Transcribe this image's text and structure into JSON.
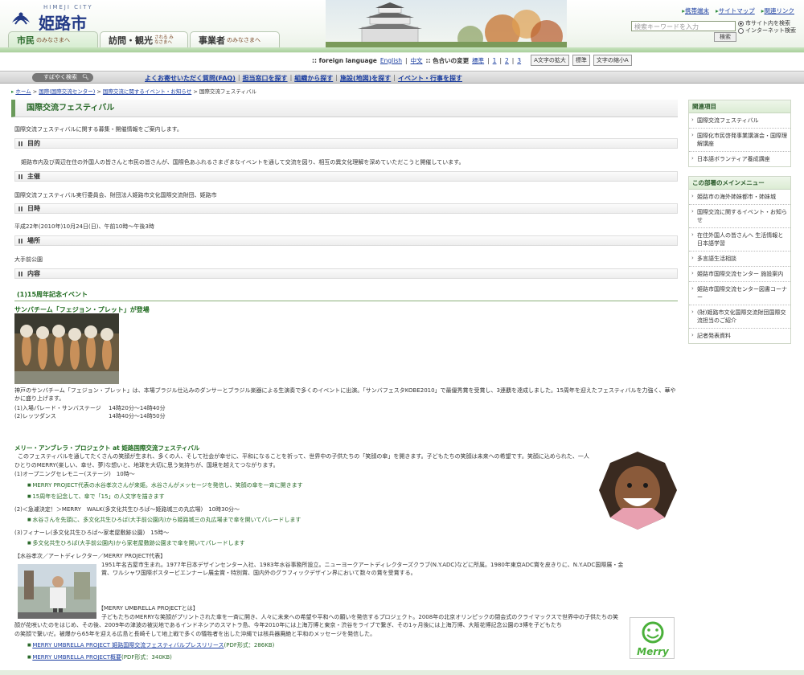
{
  "header": {
    "logo_sub": "HIMEJI CITY",
    "logo_name": "姫路市",
    "top_links": [
      "携帯端末",
      "サイトマップ",
      "関連リンク"
    ],
    "search_placeholder": "検索キーワードを入力",
    "search_button": "検索",
    "radio_site": "市サイト内を検索",
    "radio_web": "インターネット検索",
    "tabs": [
      {
        "big": "市民",
        "small": "のみなさまへ"
      },
      {
        "big": "訪問・観光",
        "small": "される みなさまへ"
      },
      {
        "big": "事業者",
        "small": "のみなさまへ"
      }
    ]
  },
  "accessibility": {
    "foreign_label": ":: foreign language",
    "english": "English",
    "chinese": "中文",
    "color_label": ":: 色合いの変更",
    "color_std": "標準",
    "color_1": "1",
    "color_2": "2",
    "color_3": "3",
    "font_up": "A文字の拡大",
    "font_std": "標準",
    "font_down": "文字の縮小A"
  },
  "nav": {
    "quick_search": "すばやく検索",
    "links": [
      "よくお寄せいただく質問(FAQ)",
      "担当窓口を探す",
      "組織から探す",
      "施設(地図)を探す",
      "イベント・行事を探す"
    ]
  },
  "breadcrumb": {
    "home": "ホーム",
    "c1": "国際(国際交流センター)",
    "c2": "国際交流に関するイベント・お知らせ",
    "current": "国際交流フェスティバル"
  },
  "page": {
    "title": "国際交流フェスティバル",
    "intro": "国際交流フェスティバルに関する募集・開催情報をご案内します。",
    "sections": {
      "purpose_h": "目的",
      "purpose": "姫路市内及び周辺在住の外国人の皆さんと市民の皆さんが、国際色あふれるさまざまなイベントを通して交流を図り、相互の異文化理解を深めていただこうと開催しています。",
      "host_h": "主催",
      "host": "国際交流フェスティバル実行委員会、財団法人姫路市文化国際交流財団、姫路市",
      "date_h": "日時",
      "date": "平成22年(2010年)10月24日(日)、午前10時～午後3時",
      "place_h": "場所",
      "place": "大手前公園",
      "content_h": "内容"
    },
    "event_heading": "(1)15周年記念イベント",
    "samba_heading": "サンバチーム「フェジョン・プレット」が登場",
    "samba_text": "神戸のサンバチーム「フェジョン・プレット」は、本場ブラジル仕込みのダンサーとブラジル楽器による生演奏で多くのイベントに出演。「サンバフェスタKOBE2010」で最優秀賞を受賞し、3連覇を達成しました。15周年を迎えたフェスティバルを力強く、華やかに盛り上げます。",
    "samba_sched": [
      {
        "label": "(1)入場パレード・サンバステージ",
        "time": "14時20分～14時40分"
      },
      {
        "label": "(2)レッツダンス",
        "time": "14時40分～14時50分"
      }
    ],
    "merry_heading": "メリー・アンブレラ・プロジェクト at 姫路国際交流フェスティバル",
    "merry_text1": "このフェスティバルを通してたくさんの笑顔が生まれ、多くの人、そして社会が幸せに、平和になることを祈って、世界中の子供たちの「笑顔の傘」を開きます。子どもたちの笑顔は未来への希望です。笑顔に込められた、一人",
    "merry_text2": "ひとりのMERRY(楽しい、幸せ、夢)な想いと、地球を大切に思う気持ちが、国境を越えてつながります。",
    "opening": "(1)オープニングセレモニー(ステージ)　10時～",
    "opening_b1": "MERRY PROJECT代表の水谷孝次さんが来姫。水谷さんがメッセージを発信し、笑顔の傘を一斉に開きます",
    "opening_b2": "15周年を記念して、傘で「15」の人文字を描きます",
    "walk": "(2)＜急遽決定！＞MERRY　WALK(多文化共生ひろば～姫路城三の丸広場)　10時30分～",
    "walk_b1": "水谷さんを先頭に、多文化共生ひろば(大手前公園内)から姫路城三の丸広場まで傘を開いてパレードします",
    "finale": "(3)フィナーレ(多文化共生ひろば～家老屋敷跡公園)　15時～",
    "finale_b1": "多文化共生ひろば(大手前公園内)から家老屋敷跡公園まで傘を開いてパレードします",
    "director_heading": "【水谷孝次／アートディレクター／MERRY PROJECT代表】",
    "director_text": "1951年名古屋市生まれ。1977年日本デザインセンター入社、1983年水谷事務所設立。ニューヨークアートディレクターズクラブ(N.Y.ADC)などに所属。1980年東京ADC賞を皮きりに、N.Y.ADC国際展・金賞、ワルシャワ国際ポスタービエンナーレ展金賞・特別賞、国内外のグラフィックデザイン界において数々の賞を受賞する。",
    "about_heading": "【MERRY UMBRELLA PROJECTとは】",
    "about_text1": "子どもたちのMERRYな笑顔がプリントされた傘を一斉に開き、人々に未来への希望や平和への願いを発信するプロジェクト。2008年の北京オリンピックの閉会式のクライマックスで世界中の子供たちの笑",
    "about_text2": "顔が花咲いたのをはじめ、その後、2009年の津波の被災地であるインドネシアのスマトラ島、今年2010年には上海万博と東京・渋谷をライブで繋ぎ、その1ヶ月後には上海万博、大阪花博記念公園の3博を子どもたち",
    "about_text3": "の笑顔で繋いだ。被爆から65年を迎える広島と長崎そして地上戦で多くの犠牲者を出した沖縄では核兵器廃絶と平和のメッセージを発信した。",
    "link1": "MERRY UMBRELLA PROJECT 姫路国際交流フェスティバルプレスリリース",
    "link1_meta": "(PDF形式：286KB)",
    "link2": "MERRY UMBRELLA PROJECT概要",
    "link2_meta": "(PDF形式：340KB)",
    "merry_logo": "Merry"
  },
  "sidebar": {
    "related_h": "関連項目",
    "related": [
      "国際交流フェスティバル",
      "国際化市民啓発事業講演会・国際理解講座",
      "日本語ボランティア養成講座"
    ],
    "menu_h": "この部署のメインメニュー",
    "menu": [
      "姫路市の海外姉妹都市・姉妹城",
      "国際交流に関するイベント・お知らせ",
      "在住外国人の皆さんへ 生活情報と日本語学習",
      "多言語生活相談",
      "姫路市国際交流センター 施設案内",
      "姫路市国際交流センター図書コーナー",
      "(財)姫路市文化国際交流財団国際交流担当のご紹介",
      "記者発表資料"
    ]
  },
  "colors": {
    "brand": "#233a86",
    "accent_green": "#1e6a1e",
    "link": "#1a3da0"
  }
}
